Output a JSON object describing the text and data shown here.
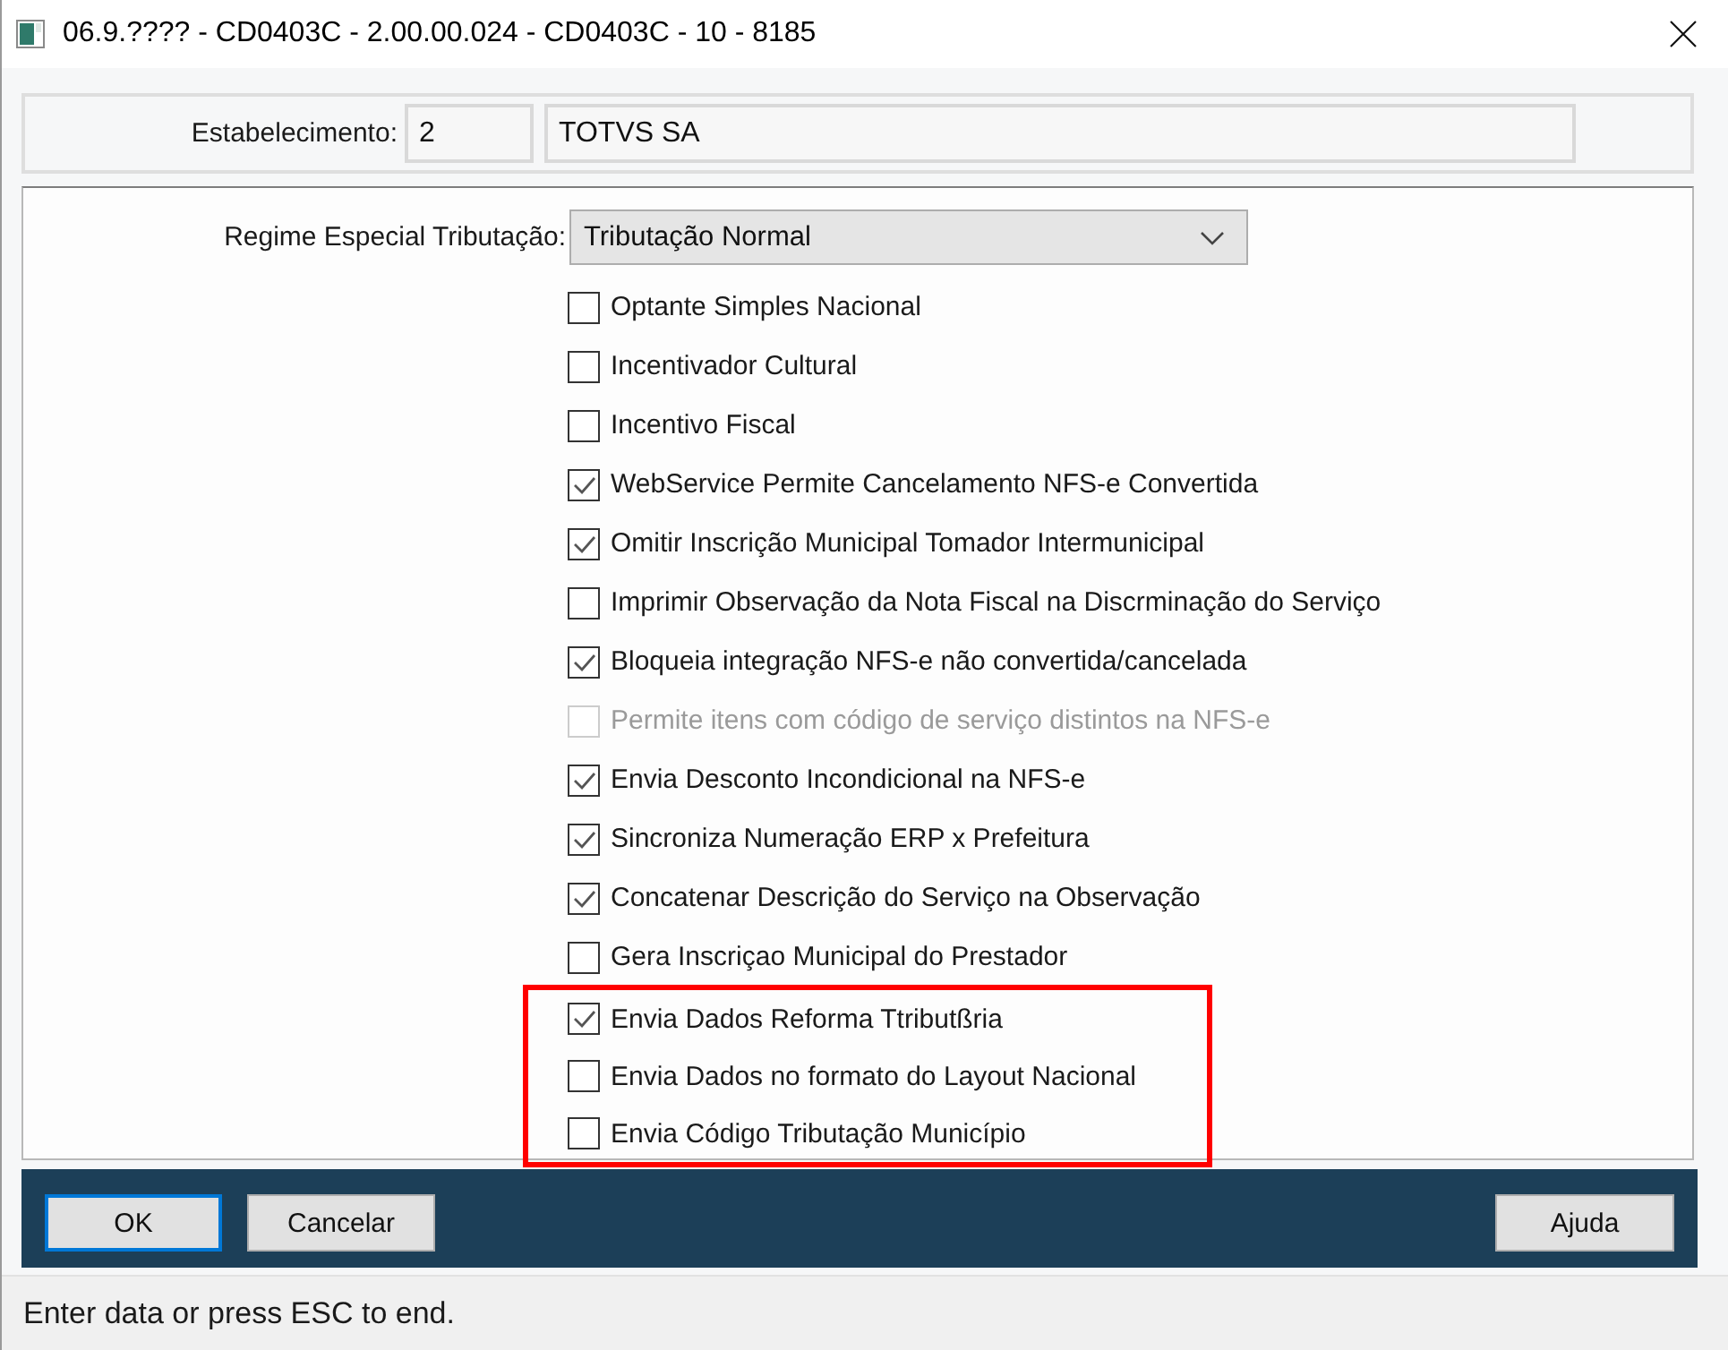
{
  "window": {
    "title": "06.9.???? - CD0403C - 2.00.00.024 - CD0403C - 10 - 8185"
  },
  "establishment": {
    "label": "Estabelecimento:",
    "code": "2",
    "name": "TOTVS SA"
  },
  "regime": {
    "label": "Regime Especial Tributação:",
    "value": "Tributação Normal"
  },
  "options": [
    {
      "label": "Optante Simples Nacional",
      "checked": false,
      "disabled": false
    },
    {
      "label": "Incentivador Cultural",
      "checked": false,
      "disabled": false
    },
    {
      "label": "Incentivo Fiscal",
      "checked": false,
      "disabled": false
    },
    {
      "label": "WebService Permite Cancelamento NFS-e Convertida",
      "checked": true,
      "disabled": false
    },
    {
      "label": "Omitir Inscrição Municipal Tomador Intermunicipal",
      "checked": true,
      "disabled": false
    },
    {
      "label": "Imprimir Observação da Nota Fiscal na Discrminação do Serviço",
      "checked": false,
      "disabled": false
    },
    {
      "label": "Bloqueia integração NFS-e não convertida/cancelada",
      "checked": true,
      "disabled": false
    },
    {
      "label": "Permite itens com código de serviço distintos na NFS-e",
      "checked": false,
      "disabled": true
    },
    {
      "label": "Envia Desconto Incondicional na NFS-e",
      "checked": true,
      "disabled": false
    },
    {
      "label": "Sincroniza Numeração ERP x Prefeitura",
      "checked": true,
      "disabled": false
    },
    {
      "label": "Concatenar Descrição do Serviço na Observação",
      "checked": true,
      "disabled": false
    },
    {
      "label": "Gera Inscriçao Municipal do Prestador",
      "checked": false,
      "disabled": false
    }
  ],
  "highlighted_options": [
    {
      "label": "Envia Dados Reforma Ttributßria",
      "checked": true,
      "disabled": false
    },
    {
      "label": "Envia Dados no formato do Layout Nacional",
      "checked": false,
      "disabled": false
    },
    {
      "label": "Envia Código Tributação Município",
      "checked": false,
      "disabled": false
    }
  ],
  "buttons": {
    "left": [
      {
        "label": "OK",
        "focused": true
      },
      {
        "label": "Cancelar",
        "focused": false
      }
    ],
    "right": [
      {
        "label": "Ajuda",
        "focused": false
      }
    ]
  },
  "status_bar": {
    "text": "Enter data or press ESC to end."
  }
}
